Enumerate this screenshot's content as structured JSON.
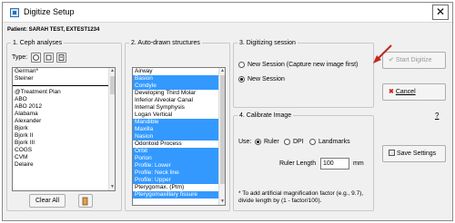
{
  "window": {
    "title": "Digitize Setup",
    "close_glyph": "✕"
  },
  "patient_label": "Patient: SARAH TEST, EXTEST1234",
  "ceph": {
    "label": "1. Ceph analyses",
    "type_label": "Type:",
    "items": [
      "German*",
      "Steiner",
      "",
      "@Treatment Plan",
      "ABO",
      "ABO 2012",
      "Alabama",
      "Alexander",
      "Bjork",
      "Bjork II",
      "Bjork III",
      "COGS",
      "CVM",
      "Delaire"
    ],
    "clear_all": "Clear All"
  },
  "structures": {
    "label": "2. Auto-drawn structures",
    "items": [
      {
        "text": "Airway",
        "selected": false
      },
      {
        "text": "Basion",
        "selected": true
      },
      {
        "text": "Condyle",
        "selected": true
      },
      {
        "text": "Developing Third Molar",
        "selected": false
      },
      {
        "text": "Inferior Alveolar Canal",
        "selected": false
      },
      {
        "text": "Internal Symphysis",
        "selected": false
      },
      {
        "text": "Logan Vertical",
        "selected": false
      },
      {
        "text": "Mandible",
        "selected": true
      },
      {
        "text": "Maxilla",
        "selected": true
      },
      {
        "text": "Nasion",
        "selected": true
      },
      {
        "text": "Odontoid Process",
        "selected": false
      },
      {
        "text": "Orbit",
        "selected": true
      },
      {
        "text": "Porion",
        "selected": true
      },
      {
        "text": "Profile: Lower",
        "selected": true
      },
      {
        "text": "Profile: Neck line",
        "selected": true
      },
      {
        "text": "Profile: Upper",
        "selected": true
      },
      {
        "text": "Pterygomax. (Ptm)",
        "selected": false
      },
      {
        "text": "Pterygomaxillary fissure",
        "selected": true
      }
    ]
  },
  "session": {
    "label": "3. Digitizing session",
    "new_capture": "New Session (Capture new image first)",
    "new_session": "New Session"
  },
  "calibrate": {
    "label": "4. Calibrate Image",
    "use_label": "Use:",
    "ruler": "Ruler",
    "dpi": "DPI",
    "landmarks": "Landmarks",
    "ruler_length_label": "Ruler Length",
    "ruler_length_value": "100",
    "unit": "mm",
    "note": "* To add artificial magnification factor (e.g., 9.7), divide length by (1 - factor/100)."
  },
  "buttons": {
    "start": "Start Digitize",
    "cancel": "Cancel",
    "help": "?",
    "save": "Save Settings"
  },
  "colors": {
    "selection": "#3399ff",
    "cancel_x": "#d42020",
    "start_check": "#a8c8a0",
    "arrow": "#c0281e"
  }
}
